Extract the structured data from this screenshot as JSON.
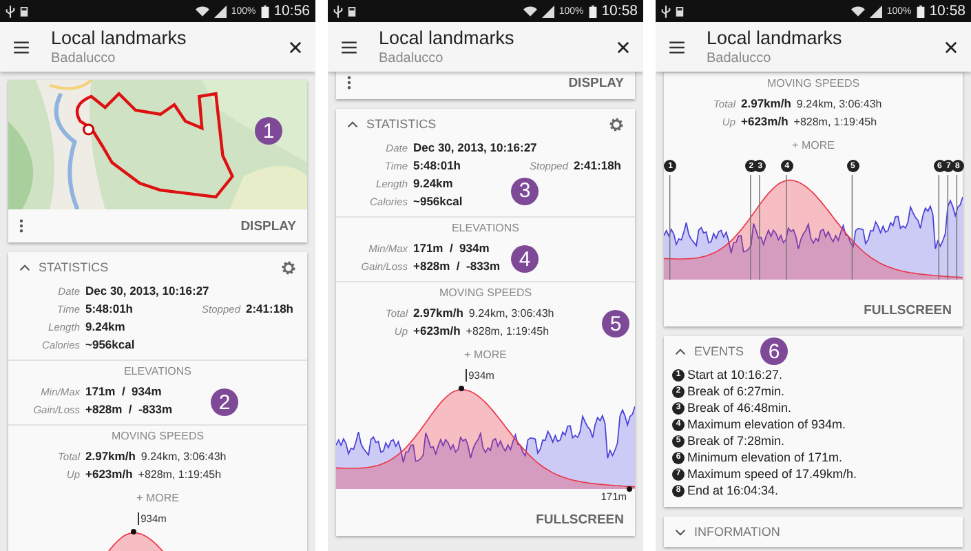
{
  "screens": [
    {
      "status_bar": {
        "battery": "100%",
        "time": "10:56"
      },
      "app_bar": {
        "title": "Local landmarks",
        "subtitle": "Badalucco"
      },
      "cards": [
        {
          "kind": "map",
          "callout": "1",
          "action": "DISPLAY"
        },
        {
          "kind": "stats",
          "title": "STATISTICS",
          "expanded": true,
          "blocks": [
            {
              "kind": "rows",
              "rows": [
                {
                  "label": "Date",
                  "value": "Dec 30, 2013, 10:16:27"
                },
                {
                  "label": "Time",
                  "value": "5:48:01h",
                  "side_label": "Stopped",
                  "side_value": "2:41:18h"
                },
                {
                  "label": "Length",
                  "value": "9.24km"
                },
                {
                  "label": "Calories",
                  "value": "~956kcal"
                }
              ]
            },
            {
              "kind": "heading",
              "text": "ELEVATIONS"
            },
            {
              "kind": "rows",
              "callout": "2",
              "rows": [
                {
                  "label": "Min/Max",
                  "value": "171m  /  934m"
                },
                {
                  "label": "Gain/Loss",
                  "value": "+828m  /  -833m"
                }
              ]
            },
            {
              "kind": "heading",
              "text": "MOVING SPEEDS"
            },
            {
              "kind": "rows",
              "rows": [
                {
                  "label": "Total",
                  "value": "2.97km/h",
                  "detail": "9.24km, 3:06:43h"
                },
                {
                  "label": "Up",
                  "value": "+623m/h",
                  "detail": "+828m, 1:19:45h"
                }
              ]
            },
            {
              "kind": "more",
              "text": "+ MORE"
            },
            {
              "kind": "chart",
              "peak_label": "934m",
              "speed_series": false,
              "cropped": true
            }
          ]
        }
      ]
    },
    {
      "status_bar": {
        "battery": "100%",
        "time": "10:58"
      },
      "app_bar": {
        "title": "Local landmarks",
        "subtitle": "Badalucco"
      },
      "cards": [
        {
          "kind": "actions",
          "action": "DISPLAY"
        },
        {
          "kind": "stats",
          "title": "STATISTICS",
          "expanded": true,
          "blocks": [
            {
              "kind": "rows",
              "callout": "3",
              "rows": [
                {
                  "label": "Date",
                  "value": "Dec 30, 2013, 10:16:27"
                },
                {
                  "label": "Time",
                  "value": "5:48:01h",
                  "side_label": "Stopped",
                  "side_value": "2:41:18h"
                },
                {
                  "label": "Length",
                  "value": "9.24km"
                },
                {
                  "label": "Calories",
                  "value": "~956kcal"
                }
              ]
            },
            {
              "kind": "heading",
              "text": "ELEVATIONS"
            },
            {
              "kind": "rows",
              "callout": "4",
              "rows": [
                {
                  "label": "Min/Max",
                  "value": "171m  /  934m"
                },
                {
                  "label": "Gain/Loss",
                  "value": "+828m  /  -833m"
                }
              ]
            },
            {
              "kind": "heading",
              "text": "MOVING SPEEDS"
            },
            {
              "kind": "rows",
              "callout": "5",
              "rows": [
                {
                  "label": "Total",
                  "value": "2.97km/h",
                  "detail": "9.24km, 3:06:43h"
                },
                {
                  "label": "Up",
                  "value": "+623m/h",
                  "detail": "+828m, 1:19:45h"
                }
              ]
            },
            {
              "kind": "more",
              "text": "+ MORE"
            },
            {
              "kind": "chart",
              "peak_label": "934m",
              "low_label": "171m",
              "speed_series": true
            },
            {
              "kind": "action",
              "text": "FULLSCREEN"
            }
          ]
        }
      ]
    },
    {
      "status_bar": {
        "battery": "100%",
        "time": "10:58"
      },
      "app_bar": {
        "title": "Local landmarks",
        "subtitle": "Badalucco"
      },
      "cards": [
        {
          "kind": "stats",
          "blocks": [
            {
              "kind": "heading",
              "text": "MOVING SPEEDS"
            },
            {
              "kind": "rows",
              "rows": [
                {
                  "label": "Total",
                  "value": "2.97km/h",
                  "detail": "9.24km, 3:06:43h"
                },
                {
                  "label": "Up",
                  "value": "+623m/h",
                  "detail": "+828m, 1:19:45h"
                }
              ]
            },
            {
              "kind": "more",
              "text": "+ MORE"
            },
            {
              "kind": "chart",
              "speed_series": true,
              "event_markers": [
                "1",
                "2",
                "3",
                "4",
                "5",
                "6",
                "7",
                "8"
              ]
            },
            {
              "kind": "action",
              "text": "FULLSCREEN"
            }
          ]
        },
        {
          "kind": "events",
          "title": "EVENTS",
          "expanded": true,
          "callout": "6",
          "items": [
            {
              "number": "1",
              "text": "Start at 10:16:27."
            },
            {
              "number": "2",
              "text": "Break of 6:27min."
            },
            {
              "number": "3",
              "text": "Break of 46:48min."
            },
            {
              "number": "4",
              "text": "Maximum elevation of 934m."
            },
            {
              "number": "5",
              "text": "Break of 7:28min."
            },
            {
              "number": "6",
              "text": "Minimum elevation of 171m."
            },
            {
              "number": "7",
              "text": "Maximum speed of 17.49km/h."
            },
            {
              "number": "8",
              "text": "End at 16:04:34."
            }
          ]
        },
        {
          "kind": "events",
          "title": "INFORMATION",
          "expanded": false
        }
      ]
    }
  ]
}
